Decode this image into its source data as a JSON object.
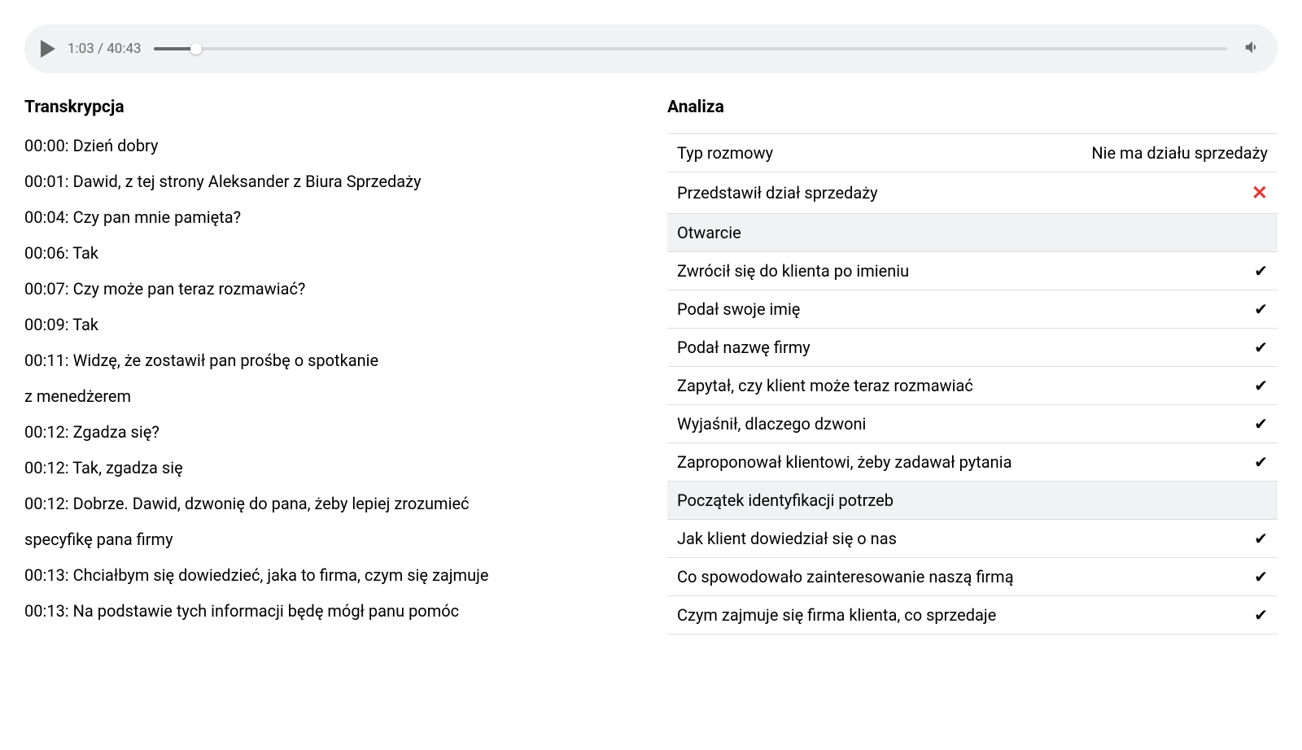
{
  "player": {
    "current_time": "1:03",
    "total_time": "40:43",
    "progress_percent": 4
  },
  "transcript": {
    "title": "Transkrypcja",
    "lines": [
      "00:00: Dzień dobry",
      "00:01: Dawid, z tej strony Aleksander z Biura Sprzedaży",
      "00:04: Czy pan mnie pamięta?",
      "00:06: Tak",
      "00:07: Czy może pan teraz rozmawiać?",
      "00:09: Tak",
      "00:11: Widzę, że zostawił pan prośbę o spotkanie",
      "z menedżerem",
      "00:12: Zgadza się?",
      "00:12: Tak, zgadza się",
      "00:12: Dobrze. Dawid, dzwonię do pana, żeby lepiej zrozumieć",
      "specyfikę pana firmy",
      "00:13: Chciałbym się dowiedzieć, jaka to firma, czym się zajmuje",
      "00:13: Na podstawie tych informacji będę mógł panu pomóc"
    ]
  },
  "analysis": {
    "title": "Analiza",
    "rows": [
      {
        "type": "text",
        "label": "Typ rozmowy",
        "value": "Nie ma działu sprzedaży"
      },
      {
        "type": "cross",
        "label": "Przedstawił dział sprzedaży"
      },
      {
        "type": "section",
        "label": "Otwarcie"
      },
      {
        "type": "check",
        "label": "Zwrócił się do klienta po imieniu"
      },
      {
        "type": "check",
        "label": "Podał swoje imię"
      },
      {
        "type": "check",
        "label": "Podał nazwę firmy"
      },
      {
        "type": "check",
        "label": "Zapytał, czy klient może teraz rozmawiać"
      },
      {
        "type": "check",
        "label": "Wyjaśnił, dlaczego dzwoni"
      },
      {
        "type": "check",
        "label": "Zaproponował klientowi, żeby zadawał pytania"
      },
      {
        "type": "section",
        "label": "Początek identyfikacji potrzeb"
      },
      {
        "type": "check",
        "label": "Jak klient dowiedział się o nas"
      },
      {
        "type": "check",
        "label": "Co spowodowało zainteresowanie naszą firmą"
      },
      {
        "type": "check",
        "label": "Czym zajmuje się firma klienta, co sprzedaje"
      }
    ]
  }
}
